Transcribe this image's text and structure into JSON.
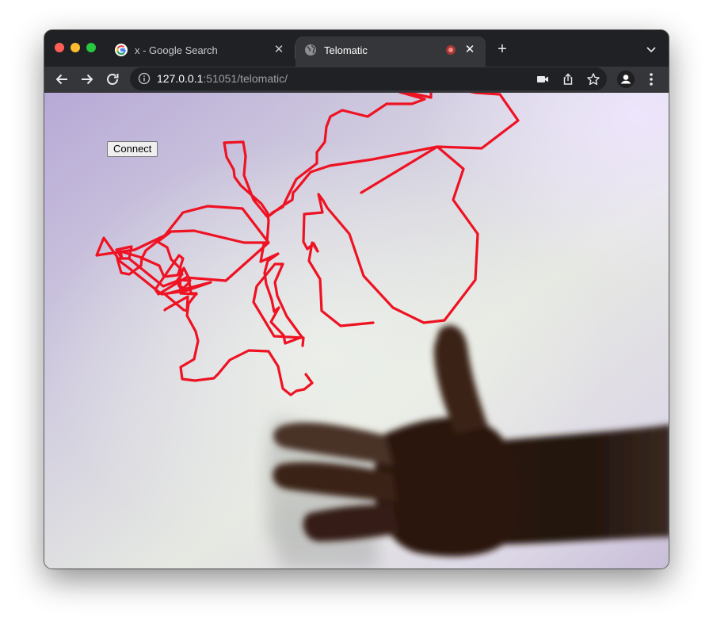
{
  "browser": {
    "tabs": [
      {
        "title": "x - Google Search",
        "favicon": "google-g-icon",
        "active": false
      },
      {
        "title": "Telomatic",
        "favicon": "globe-icon",
        "active": true,
        "recording": true
      }
    ],
    "address": {
      "host": "127.0.0.1",
      "rest": ":51051/telomatic/"
    },
    "icons": {
      "back": "arrow-left-icon",
      "forward": "arrow-right-icon",
      "reload": "reload-icon",
      "site_info": "info-icon",
      "camera": "camera-icon",
      "share": "share-icon",
      "bookmark": "star-icon",
      "profile": "person-icon",
      "menu": "kebab-menu-icon"
    }
  },
  "page": {
    "connect_label": "Connect",
    "stroke_color": "#ee1222"
  }
}
